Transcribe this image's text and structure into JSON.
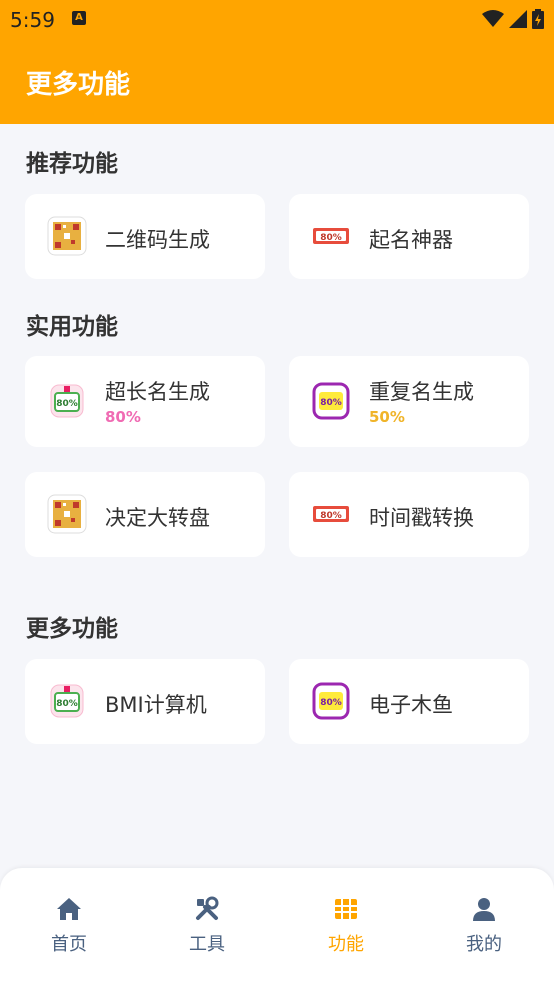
{
  "status_bar": {
    "time": "5:59",
    "notif_icon": "a-icon"
  },
  "app_bar": {
    "title": "更多功能"
  },
  "sections": [
    {
      "title": "推荐功能",
      "items": [
        {
          "label": "二维码生成",
          "icon": "qr-badge-icon"
        },
        {
          "label": "起名神器",
          "icon": "tag-badge-icon"
        }
      ]
    },
    {
      "title": "实用功能",
      "items": [
        {
          "label": "超长名生成",
          "progress": "80%",
          "progress_color": "#f06bb3",
          "icon": "flag-badge-icon"
        },
        {
          "label": "重复名生成",
          "progress": "50%",
          "progress_color": "#f0b429",
          "icon": "purple-badge-icon"
        },
        {
          "label": "决定大转盘",
          "icon": "qr-badge-icon"
        },
        {
          "label": "时间戳转换",
          "icon": "tag-badge-icon"
        }
      ]
    },
    {
      "title": "更多功能",
      "items": [
        {
          "label": "BMI计算机",
          "icon": "flag-badge-icon"
        },
        {
          "label": "电子木鱼",
          "icon": "purple-badge-icon"
        }
      ]
    }
  ],
  "bottom_nav": [
    {
      "label": "首页",
      "icon": "home-icon"
    },
    {
      "label": "工具",
      "icon": "tools-icon"
    },
    {
      "label": "功能",
      "icon": "grid-icon",
      "active": true
    },
    {
      "label": "我的",
      "icon": "person-icon"
    }
  ],
  "colors": {
    "accent": "#ffa500",
    "nav_inactive": "#4a6180",
    "background": "#f5f6fa"
  }
}
